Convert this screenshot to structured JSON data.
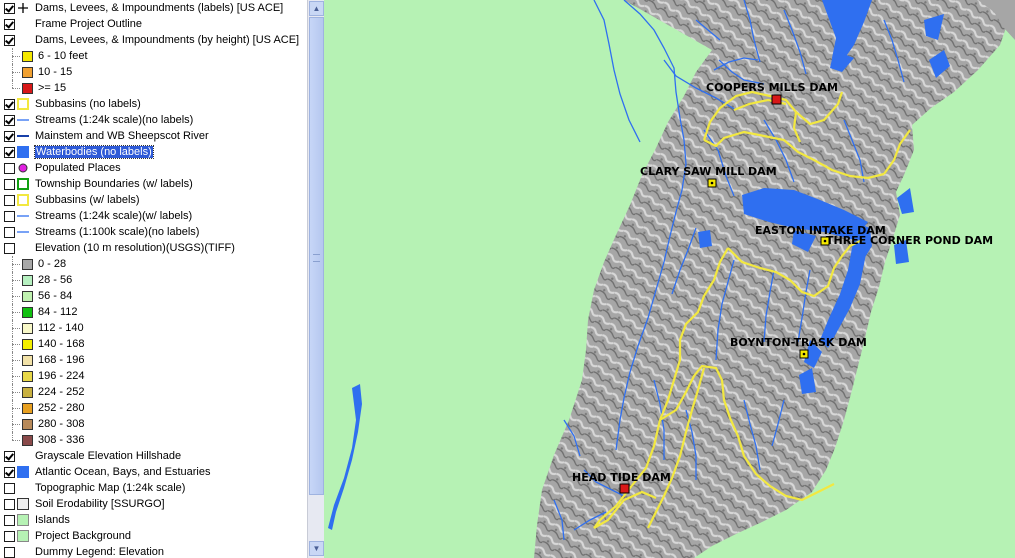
{
  "toc": {
    "layers": [
      {
        "label": "Dams, Levees, & Impoundments (labels) [US ACE]",
        "checked": true,
        "symbol": "plus-icon"
      },
      {
        "label": "Frame Project Outline",
        "checked": true,
        "symbol": ""
      },
      {
        "label": "Dams, Levees, & Impoundments (by height) [US ACE]",
        "checked": true,
        "symbol": ""
      },
      {
        "label": "6 - 10 feet",
        "legend": "#f4e800"
      },
      {
        "label": "10 - 15",
        "legend": "#f0a030"
      },
      {
        "label": ">= 15",
        "legend": "#d81818"
      },
      {
        "label": "Subbasins (no labels)",
        "checked": true,
        "symbol": "yellow-outline-icon"
      },
      {
        "label": "Streams (1:24k scale)(no labels)",
        "checked": true,
        "symbol": "blue-line-icon"
      },
      {
        "label": "Mainstem and WB Sheepscot River",
        "checked": true,
        "symbol": "darkblue-line-icon"
      },
      {
        "label": "Waterbodies (no labels)",
        "checked": true,
        "symbol": "blue-fill-icon",
        "selected": true
      },
      {
        "label": "Populated Places",
        "checked": false,
        "symbol": "magenta-dot-icon"
      },
      {
        "label": "Township Boundaries (w/ labels)",
        "checked": false,
        "symbol": "green-outline-icon"
      },
      {
        "label": "Subbasins (w/ labels)",
        "checked": false,
        "symbol": "yellow-outline-icon"
      },
      {
        "label": "Streams (1:24k scale)(w/ labels)",
        "checked": false,
        "symbol": "blue-line-icon"
      },
      {
        "label": "Streams (1:100k scale)(no labels)",
        "checked": false,
        "symbol": "blue-line-icon"
      },
      {
        "label": "Elevation (10 m resolution)(USGS)(TIFF)",
        "checked": false,
        "symbol": ""
      },
      {
        "label": "0 - 28",
        "legend": "#a8a8a8"
      },
      {
        "label": "28 - 56",
        "legend": "#b6f0c0"
      },
      {
        "label": "56 - 84",
        "legend": "#c0f2b0"
      },
      {
        "label": "84 - 112",
        "legend": "#10c010"
      },
      {
        "label": "112 - 140",
        "legend": "#f8f8c8"
      },
      {
        "label": "140 - 168",
        "legend": "#f4f000"
      },
      {
        "label": "168 - 196",
        "legend": "#f2e2a8"
      },
      {
        "label": "196 - 224",
        "legend": "#e8d848"
      },
      {
        "label": "224 - 252",
        "legend": "#c8b040"
      },
      {
        "label": "252 - 280",
        "legend": "#e8a020"
      },
      {
        "label": "280 - 308",
        "legend": "#b88a5a"
      },
      {
        "label": "308 - 336",
        "legend": "#8a4a4a"
      },
      {
        "label": "Grayscale Elevation Hillshade",
        "checked": true,
        "symbol": ""
      },
      {
        "label": "Atlantic Ocean, Bays, and Estuaries",
        "checked": true,
        "symbol": "blue-fill-icon"
      },
      {
        "label": "Topographic Map (1:24k scale)",
        "checked": false,
        "symbol": ""
      },
      {
        "label": "Soil Erodability [SSURGO]",
        "checked": false,
        "symbol": "gray-fill-icon"
      },
      {
        "label": "Islands",
        "checked": false,
        "symbol": "lightgreen-fill-icon"
      },
      {
        "label": "Project Background",
        "checked": false,
        "symbol": "lightgreen-fill-icon"
      },
      {
        "label": "Dummy Legend: Elevation",
        "checked": false,
        "symbol": ""
      }
    ]
  },
  "map": {
    "dams": [
      {
        "name": "COOPERS MILLS DAM",
        "class": ">= 15"
      },
      {
        "name": "CLARY SAW MILL DAM",
        "class": "6 - 10 feet"
      },
      {
        "name": "EASTON INTAKE DAM",
        "class": "6 - 10 feet"
      },
      {
        "name": "THREE CORNER POND DAM",
        "class": "6 - 10 feet"
      },
      {
        "name": "BOYNTON-TRASK DAM",
        "class": "6 - 10 feet"
      },
      {
        "name": "HEAD TIDE DAM",
        "class": ">= 15"
      }
    ],
    "colors": {
      "background": "#b6f2b4",
      "water": "#2f6ff0",
      "subbasin": "#f2e840",
      "terrain": "#a9a9a9"
    }
  }
}
